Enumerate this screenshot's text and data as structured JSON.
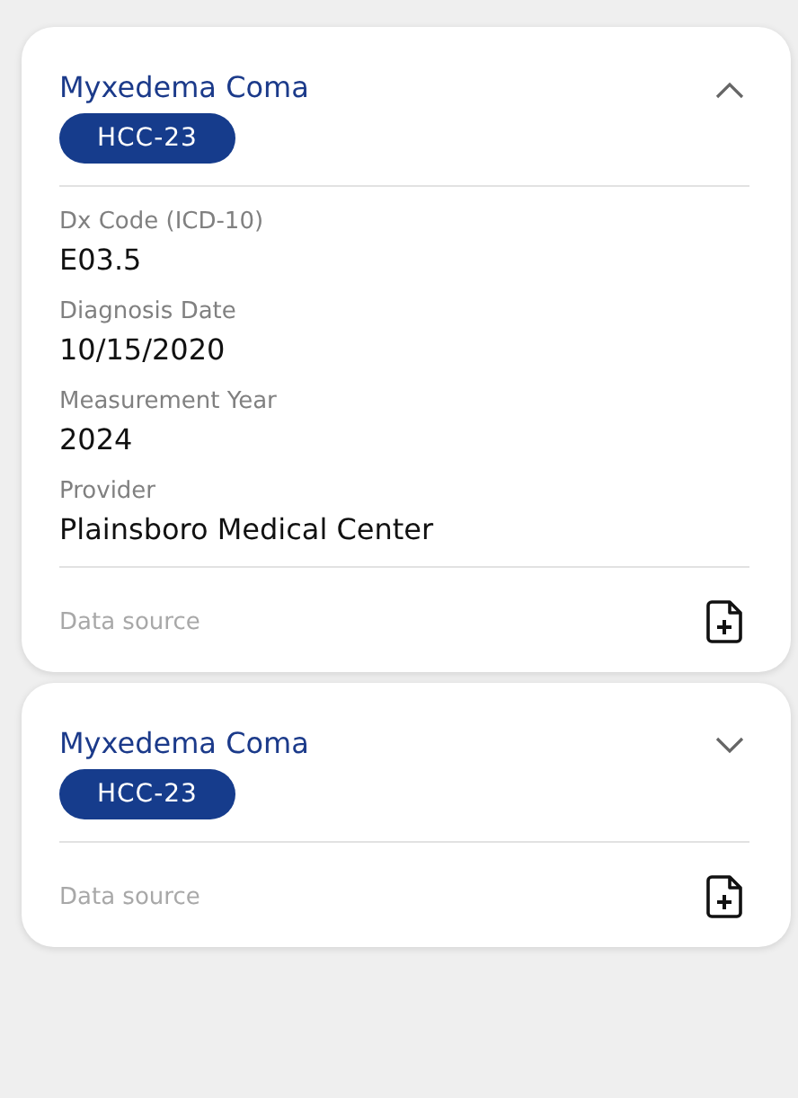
{
  "cards": [
    {
      "title": "Myxedema Coma",
      "badge": "HCC-23",
      "expanded": true,
      "fields": [
        {
          "label": "Dx Code (ICD-10)",
          "value": "E03.5"
        },
        {
          "label": "Diagnosis Date",
          "value": "10/15/2020"
        },
        {
          "label": "Measurement Year",
          "value": "2024"
        },
        {
          "label": "Provider",
          "value": "Plainsboro Medical Center"
        }
      ],
      "footer": "Data source"
    },
    {
      "title": "Myxedema Coma",
      "badge": "HCC-23",
      "expanded": false,
      "footer": "Data source"
    }
  ]
}
